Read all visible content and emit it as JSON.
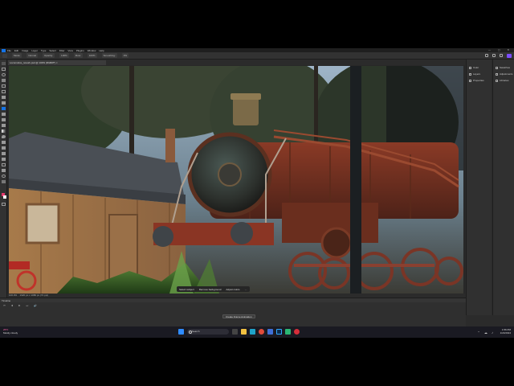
{
  "menubar": {
    "items": [
      "File",
      "Edit",
      "Image",
      "Layer",
      "Type",
      "Select",
      "Filter",
      "View",
      "Plugins",
      "Window",
      "Help"
    ],
    "window_controls": "— ▢ ✕"
  },
  "optionsbar": {
    "items": [
      "Mode:",
      "Normal",
      "Opacity:",
      "100%",
      "Flow:",
      "100%",
      "Smoothing:",
      "0%"
    ]
  },
  "document": {
    "tab_label": "Locomotive_rework.psd @ 100% (RGB/8*) ×"
  },
  "context_bar": {
    "select_subject": "Select subject",
    "remove_background": "Remove background",
    "adjust_colors": "Adjust colors"
  },
  "status": {
    "zoom": "100.0%",
    "doc_info": "1920 px x 1080 px (72 ppi)"
  },
  "panels_right1": [
    "Color",
    "Layers",
    "Properties"
  ],
  "panels_right2": [
    "Swatches",
    "Adjustments",
    "Libraries"
  ],
  "timeline": {
    "title": "Timeline",
    "create_label": "Create Frame Animation"
  },
  "taskbar": {
    "weather_temp": "25°F",
    "weather_desc": "Mostly cloudy",
    "search_placeholder": "Search",
    "time": "1:56 PM",
    "date": "1/23/2024"
  },
  "colors": {
    "accent": "#1473e6",
    "share": "#7c4dff"
  }
}
